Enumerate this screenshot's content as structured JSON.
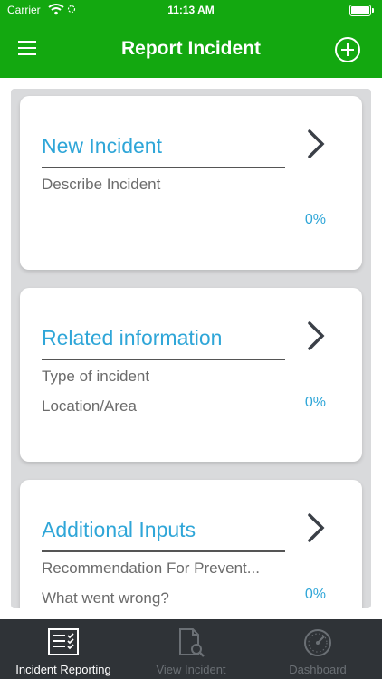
{
  "status": {
    "carrier": "Carrier",
    "time": "11:13 AM"
  },
  "nav": {
    "title": "Report Incident"
  },
  "cards": [
    {
      "title": "New Incident",
      "line1": "Describe Incident",
      "line2": "",
      "percent": "0%"
    },
    {
      "title": "Related information",
      "line1": "Type of incident",
      "line2": "Location/Area",
      "percent": "0%"
    },
    {
      "title": "Additional Inputs",
      "line1": "Recommendation For Prevent...",
      "line2": "What went wrong?",
      "percent": "0%"
    }
  ],
  "tabs": [
    {
      "label": "Incident Reporting",
      "icon": "checklist-icon",
      "active": true
    },
    {
      "label": "View Incident",
      "icon": "document-search-icon",
      "active": false
    },
    {
      "label": "Dashboard",
      "icon": "gauge-icon",
      "active": false
    }
  ],
  "colors": {
    "brand_green": "#13a810",
    "accent_blue": "#2fa6d8",
    "tabbar": "#2f3337"
  }
}
